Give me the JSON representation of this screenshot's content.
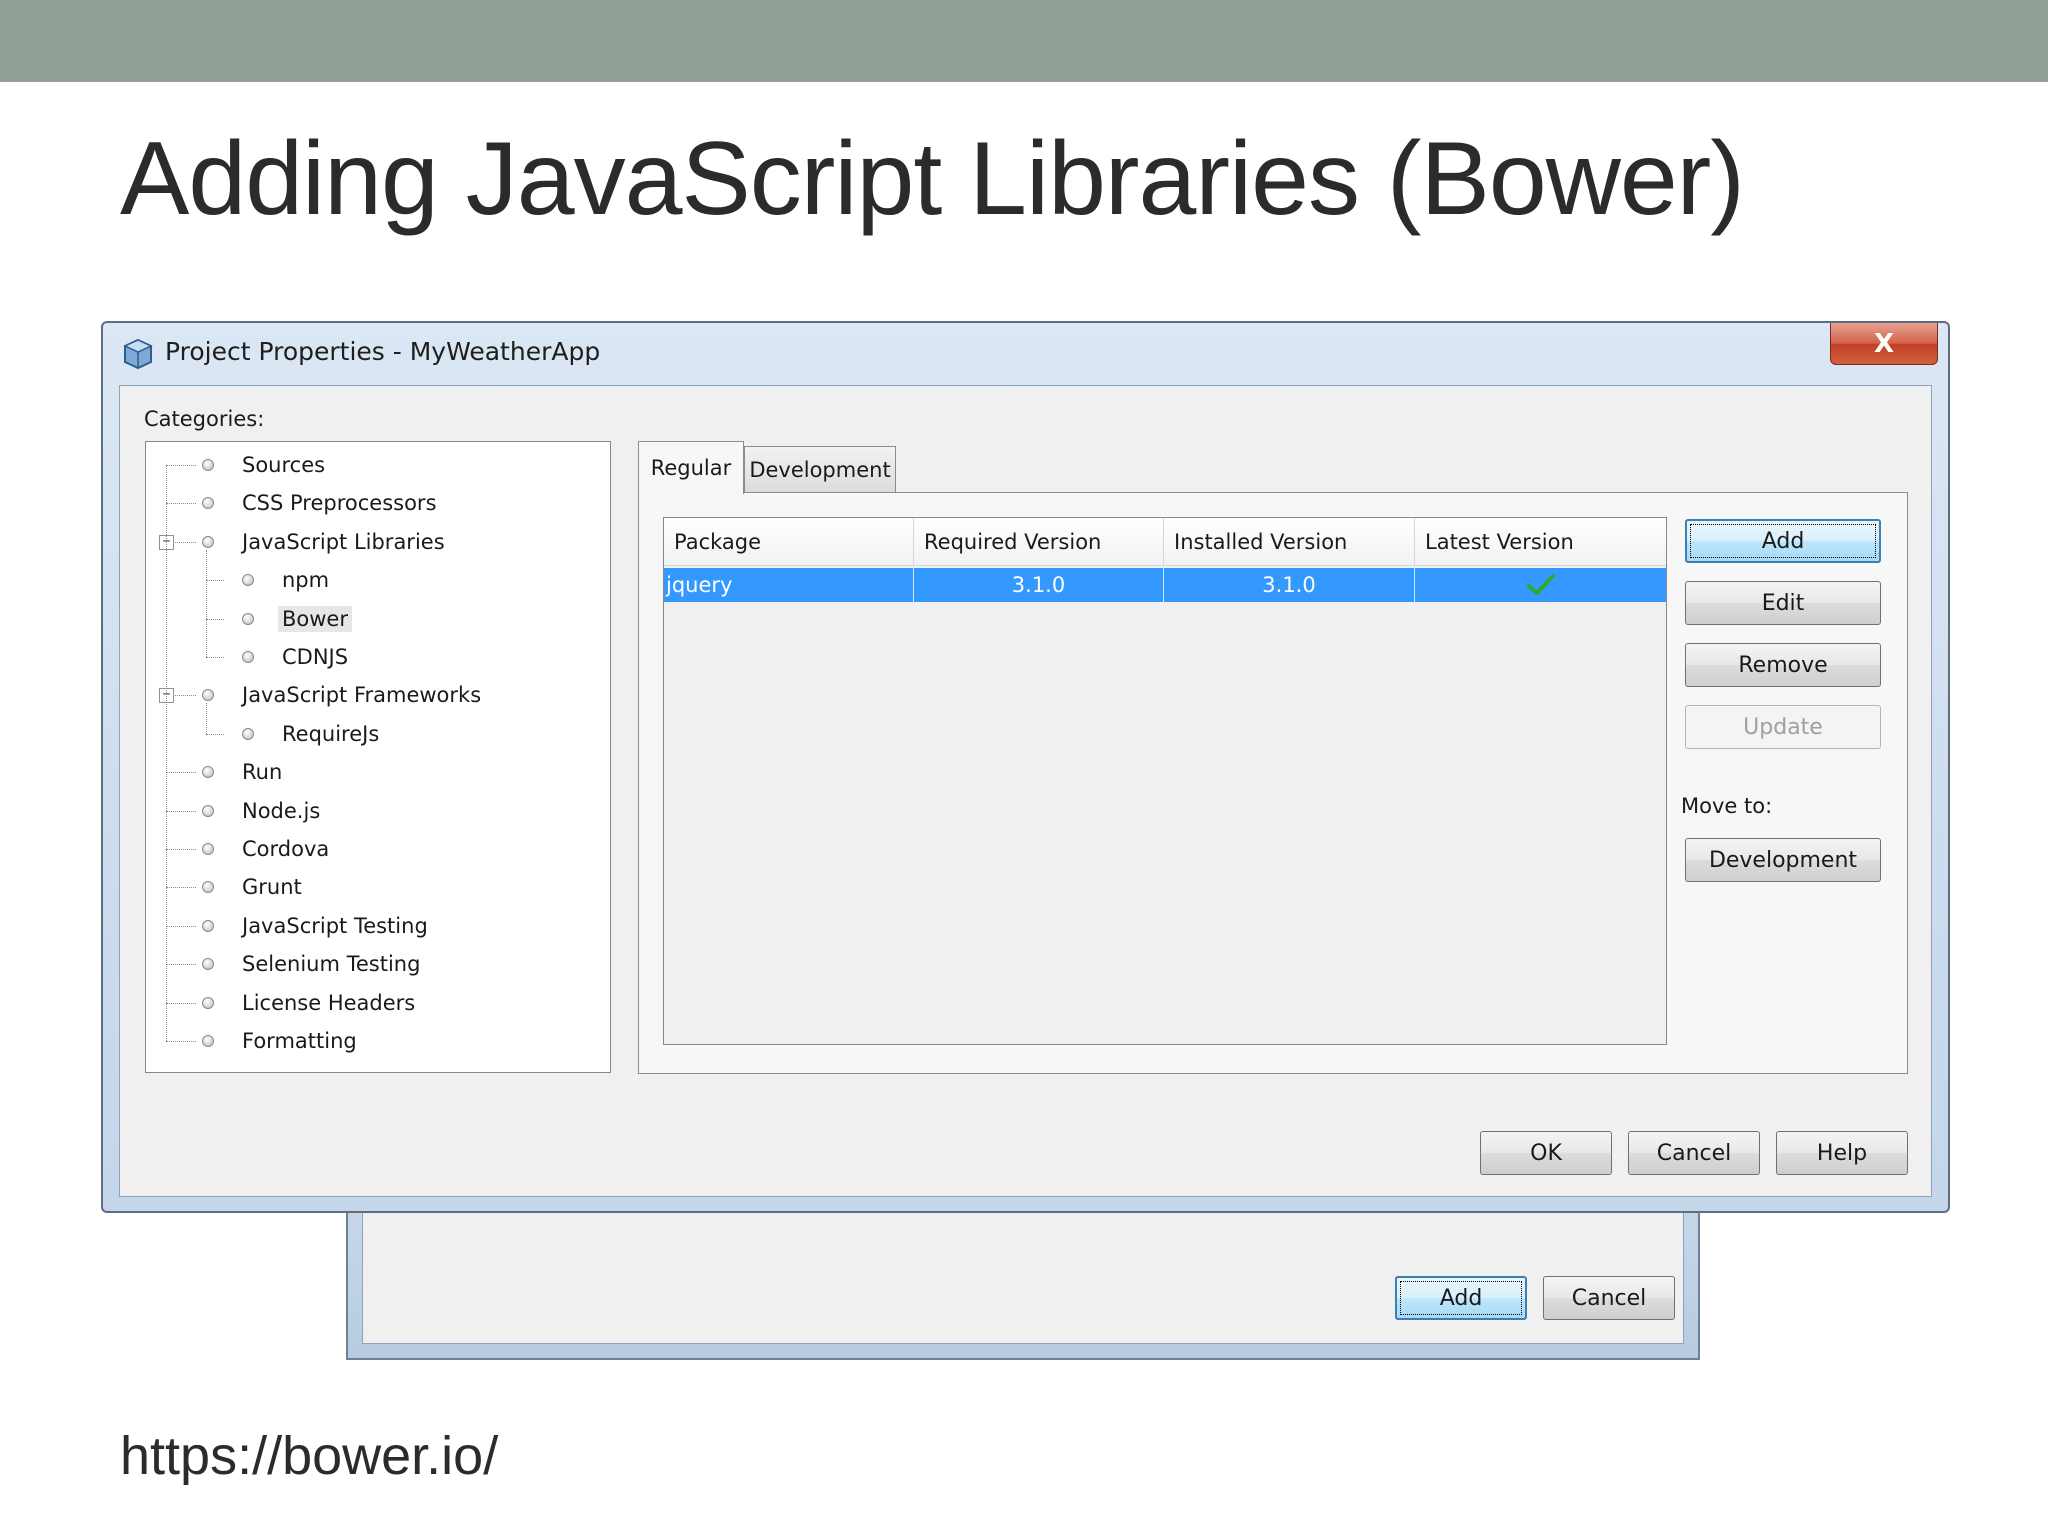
{
  "slide": {
    "title": "Adding JavaScript Libraries (Bower)",
    "url": "https://bower.io/"
  },
  "background_dialog": {
    "add_label": "Add",
    "cancel_label": "Cancel"
  },
  "dialog": {
    "title": "Project Properties - MyWeatherApp",
    "close_label": "X",
    "categories_label": "Categories:",
    "categories": [
      {
        "label": "Sources",
        "level": 0
      },
      {
        "label": "CSS Preprocessors",
        "level": 0
      },
      {
        "label": "JavaScript Libraries",
        "level": 0,
        "expanded": true
      },
      {
        "label": "npm",
        "level": 1
      },
      {
        "label": "Bower",
        "level": 1,
        "selected": true
      },
      {
        "label": "CDNJS",
        "level": 1
      },
      {
        "label": "JavaScript Frameworks",
        "level": 0,
        "expanded": true
      },
      {
        "label": "RequireJs",
        "level": 1
      },
      {
        "label": "Run",
        "level": 0
      },
      {
        "label": "Node.js",
        "level": 0
      },
      {
        "label": "Cordova",
        "level": 0
      },
      {
        "label": "Grunt",
        "level": 0
      },
      {
        "label": "JavaScript Testing",
        "level": 0
      },
      {
        "label": "Selenium Testing",
        "level": 0
      },
      {
        "label": "License Headers",
        "level": 0
      },
      {
        "label": "Formatting",
        "level": 0
      }
    ],
    "tabs": [
      {
        "label": "Regular",
        "active": true
      },
      {
        "label": "Development",
        "active": false
      }
    ],
    "table": {
      "columns": [
        "Package",
        "Required Version",
        "Installed Version",
        "Latest Version"
      ],
      "rows": [
        {
          "package": "jquery",
          "required": "3.1.0",
          "installed": "3.1.0",
          "latest_icon": "checkmark-icon",
          "selected": true
        }
      ]
    },
    "side_buttons": {
      "add": "Add",
      "edit": "Edit",
      "remove": "Remove",
      "update": "Update",
      "move_to_label": "Move to:",
      "development": "Development"
    },
    "footer_buttons": {
      "ok": "OK",
      "cancel": "Cancel",
      "help": "Help"
    }
  },
  "colors": {
    "topbar": "#919f97",
    "selection": "#3399ff",
    "checkmark": "#2fa82f"
  }
}
